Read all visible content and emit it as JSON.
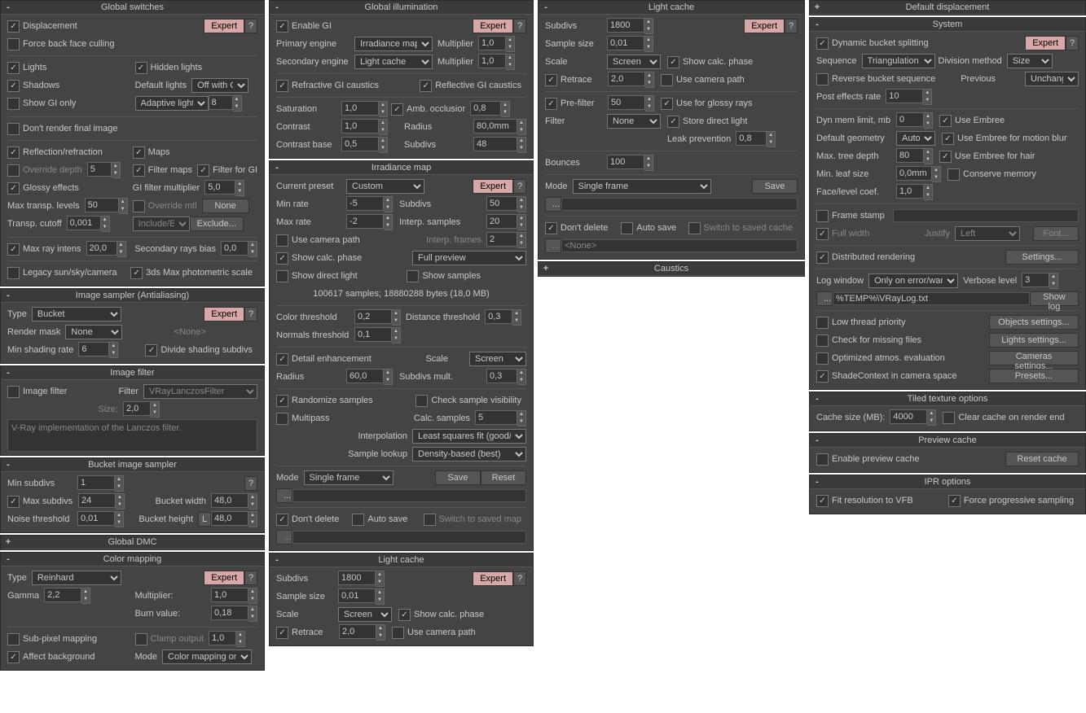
{
  "gs": {
    "hdr": "Global switches",
    "disp": "Displacement",
    "fbfc": "Force back face culling",
    "expert": "Expert",
    "q": "?",
    "lights": "Lights",
    "hidden": "Hidden lights",
    "shadows": "Shadows",
    "deflights": "Default lights",
    "deflightsv": "Off with G:",
    "sgionly": "Show GI only",
    "adaptive": "Adaptive lights",
    "adn": "8",
    "dfinal": "Don't render final image",
    "reflref": "Reflection/refraction",
    "maps": "Maps",
    "override": "Override depth",
    "ovn": "5",
    "fmaps": "Filter maps",
    "ffgi": "Filter for GI",
    "glossy": "Glossy effects",
    "gifm": "GI filter multiplier",
    "gifmv": "5,0",
    "mtl": "Max transp. levels",
    "mtlv": "50",
    "ovmtl": "Override mtl",
    "none": "None",
    "tcut": "Transp. cutoff",
    "tcutv": "0,001",
    "inclex": "Include/Ex",
    "exclude": "Exclude...",
    "mri": "Max ray intens",
    "mriv": "20,0",
    "srb": "Secondary rays bias",
    "srbv": "0,0",
    "legacy": "Legacy sun/sky/camera",
    "photo": "3ds Max photometric scale"
  },
  "is": {
    "hdr": "Image sampler (Antialiasing)",
    "type": "Type",
    "typev": "Bucket",
    "expert": "Expert",
    "rmask": "Render mask",
    "rmaskv": "None",
    "none": "<None>",
    "msr": "Min shading rate",
    "msrv": "6",
    "dss": "Divide shading subdivs"
  },
  "ifl": {
    "hdr": "Image filter",
    "ifc": "Image filter",
    "filter": "Filter",
    "filterv": "VRayLanczosFilter",
    "size": "Size:",
    "sizev": "2,0",
    "desc": "V-Ray implementation of the Lanczos filter."
  },
  "bis": {
    "hdr": "Bucket image sampler",
    "mins": "Min subdivs",
    "minsv": "1",
    "maxs": "Max subdivs",
    "maxsv": "24",
    "bw": "Bucket width",
    "bwv": "48,0",
    "nt": "Noise threshold",
    "ntv": "0,01",
    "bh": "Bucket height",
    "bhl": "L",
    "bhv": "48,0"
  },
  "gdmc": {
    "hdr": "Global DMC"
  },
  "cm": {
    "hdr": "Color mapping",
    "type": "Type",
    "typev": "Reinhard",
    "expert": "Expert",
    "gamma": "Gamma",
    "gammav": "2,2",
    "mult": "Multiplier:",
    "multv": "1,0",
    "burn": "Burn value:",
    "burnv": "0,18",
    "spm": "Sub-pixel mapping",
    "clamp": "Clamp output",
    "clampv": "1,0",
    "affbg": "Affect background",
    "mode": "Mode",
    "modev": "Color mapping only"
  },
  "gi": {
    "hdr": "Global illumination",
    "enable": "Enable GI",
    "expert": "Expert",
    "pe": "Primary engine",
    "pev": "Irradiance map",
    "mult": "Multiplier",
    "multv": "1,0",
    "se": "Secondary engine",
    "sev": "Light cache",
    "sev2": "1,0",
    "refc": "Refractive GI caustics",
    "reflc": "Reflective GI caustics",
    "sat": "Saturation",
    "satv": "1,0",
    "ao": "Amb. occlusior",
    "aov": "0,8",
    "con": "Contrast",
    "conv": "1,0",
    "rad": "Radius",
    "radv": "80,0mm",
    "cb": "Contrast base",
    "cbv": "0,5",
    "sub": "Subdivs",
    "subv": "48"
  },
  "im": {
    "hdr": "Irradiance map",
    "cp": "Current preset",
    "cpv": "Custom",
    "expert": "Expert",
    "minr": "Min rate",
    "minrv": "-5",
    "sub": "Subdivs",
    "subv": "50",
    "maxr": "Max rate",
    "maxrv": "-2",
    "is": "Interp. samples",
    "isv": "20",
    "ucp": "Use camera path",
    "ifr": "Interp. frames",
    "ifrv": "2",
    "scp": "Show calc. phase",
    "fp": "Full preview",
    "sdl": "Show direct light",
    "ss": "Show samples",
    "stats": "100617 samples; 18880288 bytes (18,0 MB)",
    "ct": "Color threshold",
    "ctv": "0,2",
    "dt": "Distance threshold",
    "dtv": "0,3",
    "nt": "Normals threshold",
    "ntv": "0,1",
    "de": "Detail enhancement",
    "scale": "Scale",
    "scalev": "Screen",
    "radius": "Radius",
    "radiusv": "60,0",
    "sm": "Subdivs mult.",
    "smv": "0,3",
    "rs": "Randomize samples",
    "csv": "Check sample visibility",
    "mp": "Multipass",
    "cs": "Calc. samples",
    "csn": "5",
    "interp": "Interpolation",
    "interpv": "Least squares fit (good/sm",
    "sl": "Sample lookup",
    "slv": "Density-based (best)",
    "mode": "Mode",
    "modev": "Single frame",
    "save": "Save",
    "reset": "Reset",
    "dots": "...",
    "dd": "Don't delete",
    "as": "Auto save",
    "stsm": "Switch to saved map"
  },
  "lc": {
    "hdr": "Light cache",
    "sub": "Subdivs",
    "subv": "1800",
    "expert": "Expert",
    "ss": "Sample size",
    "ssv": "0,01",
    "scale": "Scale",
    "scalev": "Screen",
    "scp": "Show calc. phase",
    "retr": "Retrace",
    "retrv": "2,0",
    "ucp": "Use camera path",
    "pf": "Pre-filter",
    "pfv": "50",
    "ugr": "Use for glossy rays",
    "filter": "Filter",
    "filterv": "None",
    "sdl": "Store direct light",
    "lp": "Leak prevention",
    "lpv": "0,8",
    "bounces": "Bounces",
    "bouncesv": "100",
    "mode": "Mode",
    "modev": "Single frame",
    "save": "Save",
    "dots": "...",
    "dd": "Don't delete",
    "as": "Auto save",
    "stsc": "Switch to saved cache",
    "none": "<None>"
  },
  "cau": {
    "hdr": "Caustics"
  },
  "dd": {
    "hdr": "Default displacement"
  },
  "sys": {
    "hdr": "System",
    "dbs": "Dynamic bucket splitting",
    "expert": "Expert",
    "seq": "Sequence",
    "seqv": "Triangulation",
    "dm": "Division method",
    "dmv": "Size",
    "rbs": "Reverse bucket sequence",
    "prev": "Previous",
    "prevv": "Unchange",
    "per": "Post effects rate",
    "perv": "10",
    "dml": "Dyn mem limit, mb",
    "dmlv": "0",
    "ue": "Use Embree",
    "dg": "Default geometry",
    "dgv": "Auto",
    "uemb": "Use Embree for motion blur",
    "mtd": "Max. tree depth",
    "mtdv": "80",
    "ueh": "Use Embree for hair",
    "mls": "Min. leaf size",
    "mlsv": "0,0mm",
    "cmem": "Conserve memory",
    "flc": "Face/level coef.",
    "flcv": "1,0",
    "fs": "Frame stamp",
    "fw": "Full width",
    "just": "Justify",
    "justv": "Left",
    "font": "Font...",
    "dr": "Distributed rendering",
    "settings": "Settings...",
    "lw": "Log window",
    "lwv": "Only on error/war",
    "vl": "Verbose level",
    "vlv": "3",
    "logdots": "...",
    "logpath": "%TEMP%\\VRayLog.txt",
    "showlog": "Show log",
    "ltp": "Low thread priority",
    "os": "Objects settings...",
    "cfmf": "Check for missing files",
    "ls": "Lights settings...",
    "oae": "Optimized atmos. evaluation",
    "cs": "Cameras settings...",
    "scics": "ShadeContext in camera space",
    "presets": "Presets..."
  },
  "tto": {
    "hdr": "Tiled texture options",
    "csm": "Cache size (MB):",
    "csmv": "4000",
    "ccre": "Clear cache on render end"
  },
  "pc": {
    "hdr": "Preview cache",
    "epc": "Enable preview cache",
    "rc": "Reset cache"
  },
  "ipr": {
    "hdr": "IPR options",
    "frv": "Fit resolution to VFB",
    "fps": "Force progressive sampling"
  }
}
